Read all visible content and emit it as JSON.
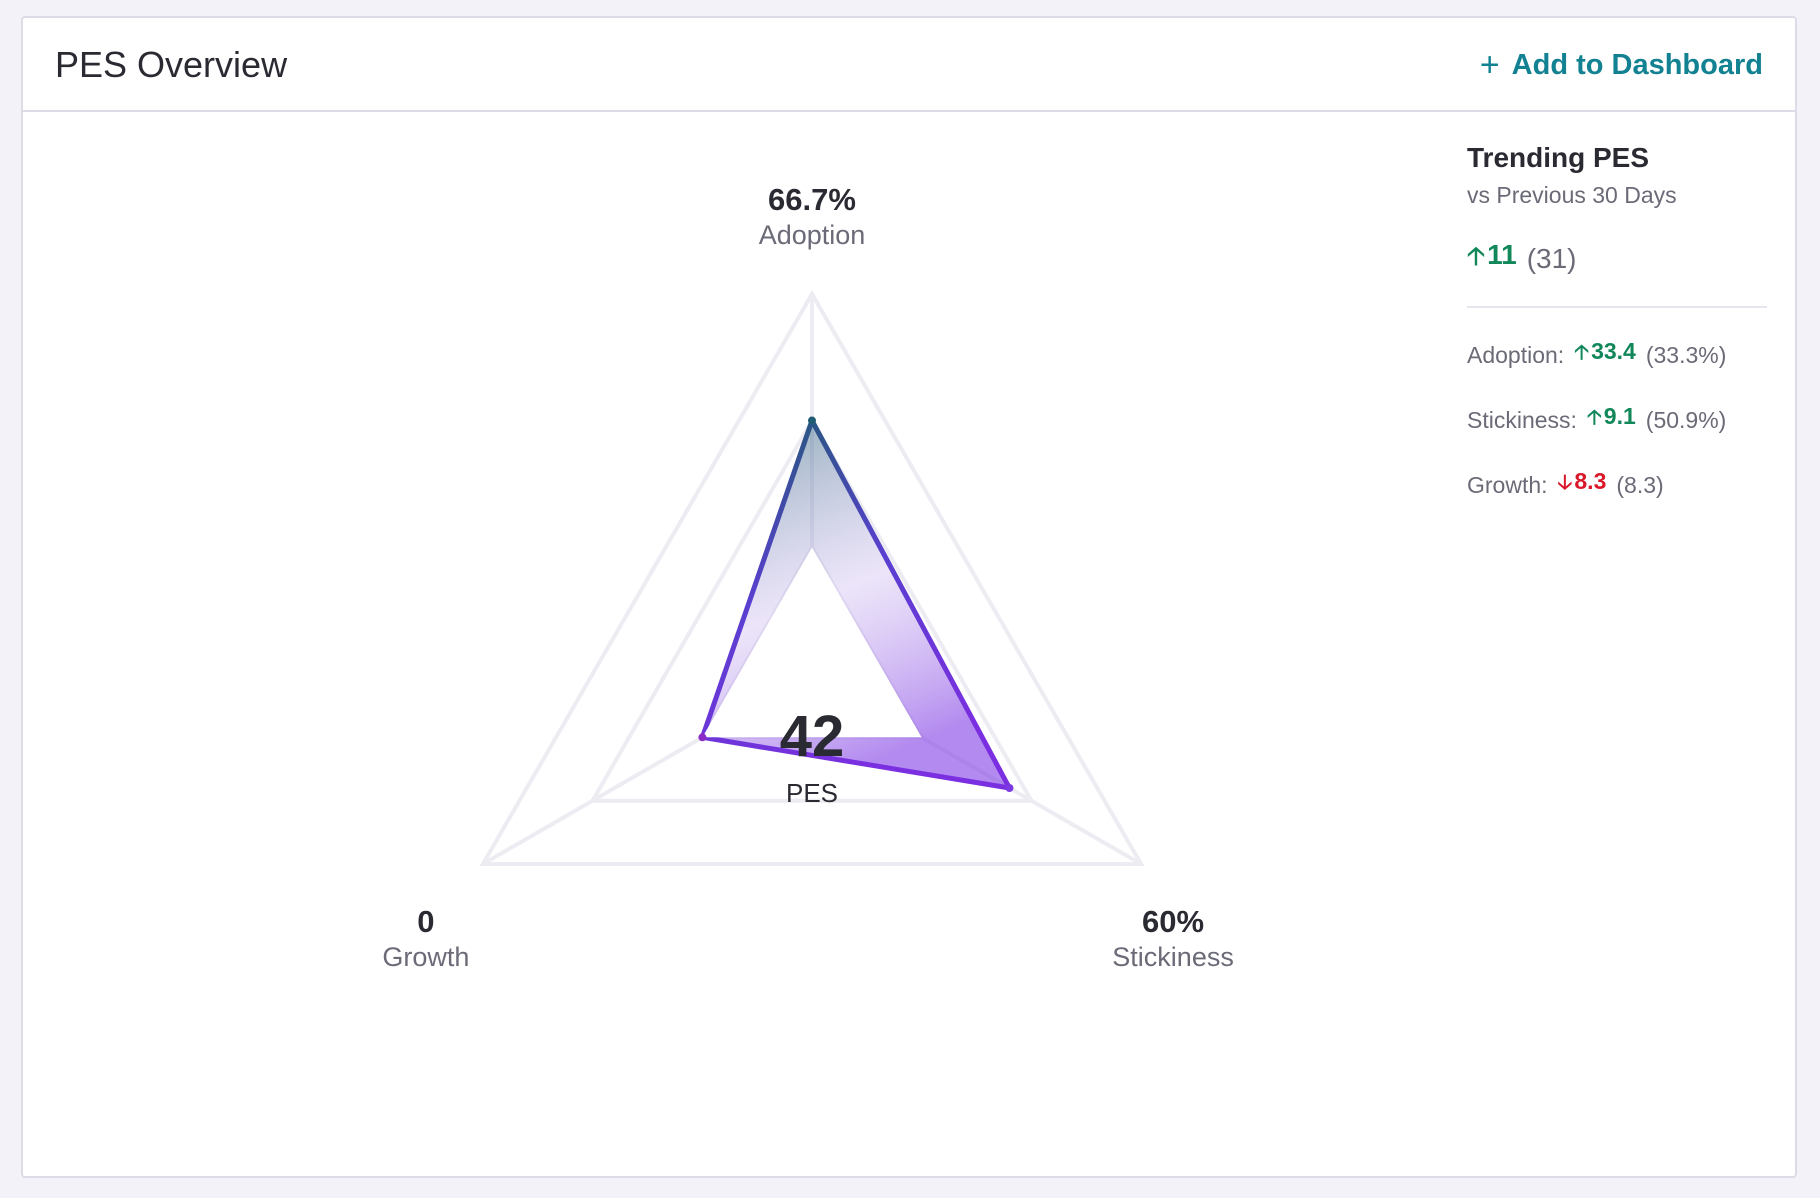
{
  "header": {
    "title": "PES Overview",
    "add_icon": "plus-icon",
    "add_label": "Add to Dashboard"
  },
  "chart_data": {
    "type": "radar",
    "axes": [
      {
        "name": "Adoption",
        "value": 66.7,
        "value_label": "66.7%"
      },
      {
        "name": "Stickiness",
        "value": 60,
        "value_label": "60%"
      },
      {
        "name": "Growth",
        "value": 0,
        "value_label": "0"
      }
    ],
    "range": [
      0,
      100
    ],
    "grid_levels": [
      33.3,
      66.7,
      100
    ],
    "center": {
      "value": "42",
      "label": "PES"
    },
    "colors": {
      "adoption_vertex": "#1f5b72",
      "stickiness_vertex": "#7a3ae0",
      "growth_vertex": "#8b2cc4",
      "grid": "#ececf2"
    }
  },
  "trending": {
    "title": "Trending PES",
    "subtitle": "vs Previous 30 Days",
    "main": {
      "direction": "up",
      "arrow_icon": "arrow-up-icon",
      "delta": "11",
      "previous": "(31)"
    },
    "metrics": [
      {
        "label": "Adoption:",
        "direction": "up",
        "arrow_icon": "arrow-up-icon",
        "delta": "33.4",
        "previous": "(33.3%)"
      },
      {
        "label": "Stickiness:",
        "direction": "up",
        "arrow_icon": "arrow-up-icon",
        "delta": "9.1",
        "previous": "(50.9%)"
      },
      {
        "label": "Growth:",
        "direction": "down",
        "arrow_icon": "arrow-down-icon",
        "delta": "8.3",
        "previous": "(8.3)"
      }
    ],
    "colors": {
      "up": "#12875a",
      "down": "#d9182a"
    }
  }
}
